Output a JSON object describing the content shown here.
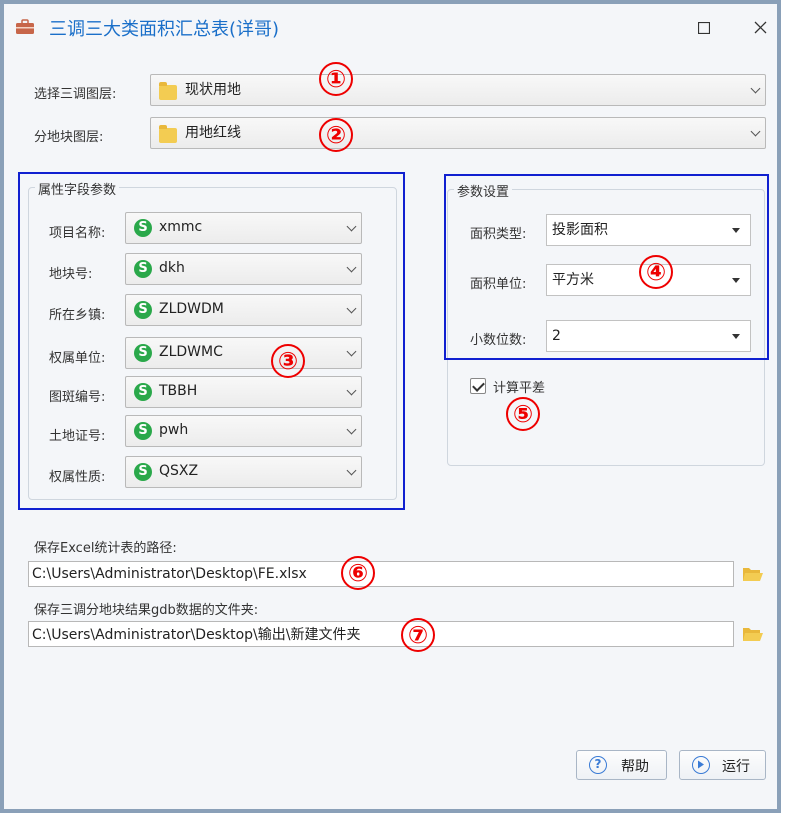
{
  "window": {
    "title": "三调三大类面积汇总表(详哥)"
  },
  "top": {
    "layer_label": "选择三调图层:",
    "layer_value": "现状用地",
    "parcel_label": "分地块图层:",
    "parcel_value": "用地红线"
  },
  "attributes": {
    "title": "属性字段参数",
    "fields": [
      {
        "label": "项目名称:",
        "value": "xmmc"
      },
      {
        "label": "地块号:",
        "value": "dkh"
      },
      {
        "label": "所在乡镇:",
        "value": "ZLDWDM"
      },
      {
        "label": "权属单位:",
        "value": "ZLDWMC"
      },
      {
        "label": "图斑编号:",
        "value": "TBBH"
      },
      {
        "label": "土地证号:",
        "value": "pwh"
      },
      {
        "label": "权属性质:",
        "value": "QSXZ"
      }
    ]
  },
  "params": {
    "title": "参数设置",
    "area_type_label": "面积类型:",
    "area_type_value": "投影面积",
    "area_unit_label": "面积单位:",
    "area_unit_value": "平方米",
    "decimals_label": "小数位数:",
    "decimals_value": "2",
    "balance_label": "计算平差",
    "balance_checked": true
  },
  "output": {
    "excel_label": "保存Excel统计表的路径:",
    "excel_path": "C:\\Users\\Administrator\\Desktop\\FE.xlsx",
    "gdb_label": "保存三调分地块结果gdb数据的文件夹:",
    "gdb_path": "C:\\Users\\Administrator\\Desktop\\输出\\新建文件夹"
  },
  "buttons": {
    "help": "帮助",
    "run": "运行"
  },
  "annotations": [
    "①",
    "②",
    "③",
    "④",
    "⑤",
    "⑥",
    "⑦"
  ],
  "colors": {
    "title": "#1a6fc9",
    "highlight_box": "#1020d0",
    "annotation": "#e00000",
    "field_icon": "#2aa84a",
    "folder": "#f3cc52"
  }
}
